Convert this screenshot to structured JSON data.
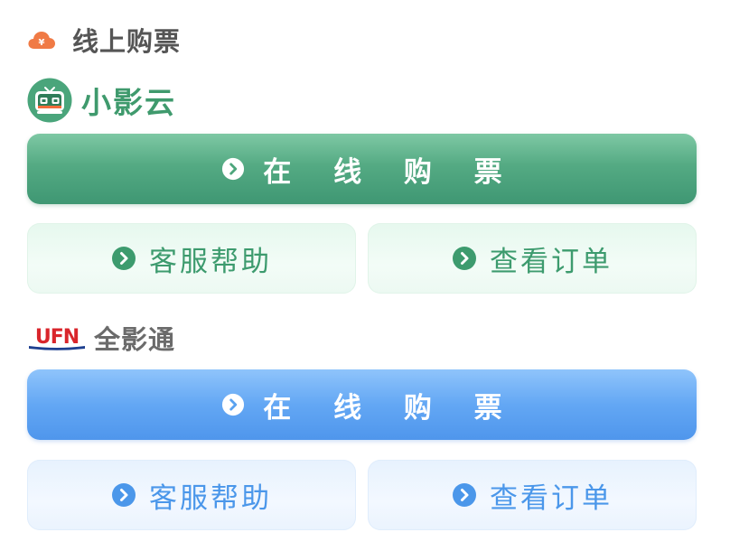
{
  "section": {
    "title": "线上购票",
    "icon": "yen-cloud-icon"
  },
  "providers": [
    {
      "brand_name": "小影云",
      "brand_icon": "xiaoyingyun-logo",
      "accent": "#4da67c",
      "buy_label": "在 线 购 票",
      "help_label": "客服帮助",
      "orders_label": "查看订单"
    },
    {
      "brand_name": "全影通",
      "brand_logo_text": "UFN",
      "brand_icon": "ufn-logo",
      "accent": "#5aa2f0",
      "buy_label": "在 线 购 票",
      "help_label": "客服帮助",
      "orders_label": "查看订单"
    }
  ],
  "colors": {
    "green_primary": "#4da67c",
    "blue_primary": "#5aa2f0",
    "title_gray": "#555555",
    "ufn_red": "#d9252b",
    "ufn_blue": "#1d3f8f"
  }
}
